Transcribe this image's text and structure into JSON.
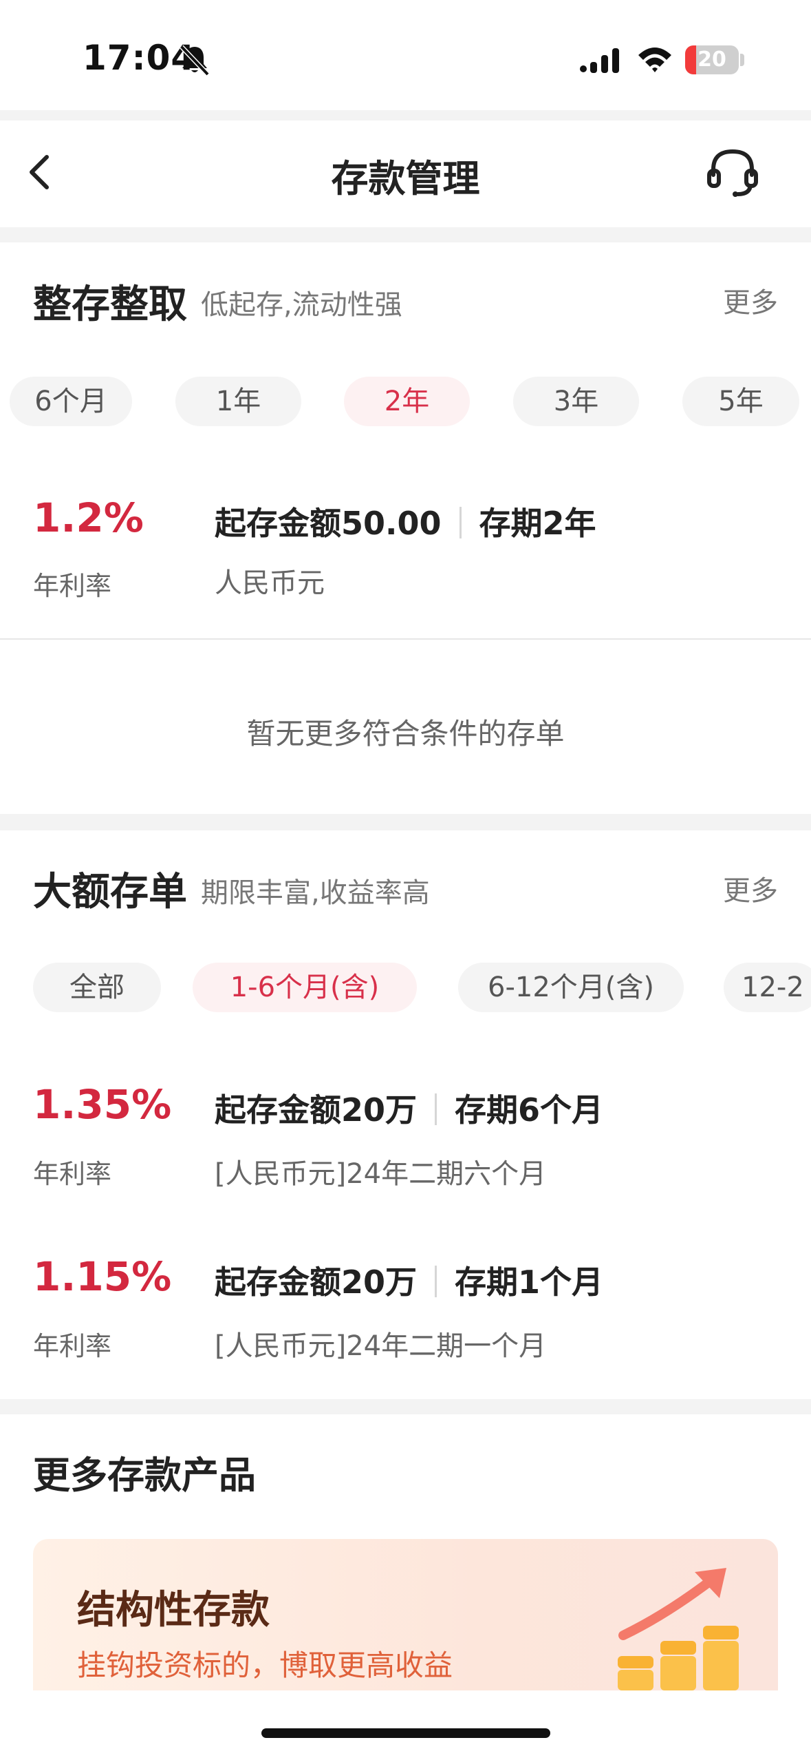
{
  "status": {
    "time": "17:04",
    "battery": 20
  },
  "nav": {
    "title": "存款管理"
  },
  "regular": {
    "title": "整存整取",
    "subtitle": "低起存,流动性强",
    "more": "更多",
    "tabs": [
      "6个月",
      "1年",
      "2年",
      "3年",
      "5年"
    ],
    "active_tab": "2年",
    "product": {
      "rate": "1.2%",
      "rate_label": "年利率",
      "min_amount": "起存金额50.00",
      "term": "存期2年",
      "currency": "人民币元"
    },
    "empty_text": "暂无更多符合条件的存单"
  },
  "large": {
    "title": "大额存单",
    "subtitle": "期限丰富,收益率高",
    "more": "更多",
    "tabs": [
      "全部",
      "1-6个月(含)",
      "6-12个月(含)",
      "12-2"
    ],
    "active_tab": "1-6个月(含)",
    "products": [
      {
        "rate": "1.35%",
        "rate_label": "年利率",
        "min_amount": "起存金额20万",
        "term": "存期6个月",
        "name": "[人民币元]24年二期六个月"
      },
      {
        "rate": "1.15%",
        "rate_label": "年利率",
        "min_amount": "起存金额20万",
        "term": "存期1个月",
        "name": "[人民币元]24年二期一个月"
      }
    ]
  },
  "more_products": {
    "title": "更多存款产品",
    "card": {
      "title": "结构性存款",
      "subtitle": "挂钩投资标的，博取更高收益",
      "icon": "rising-coins-icon"
    }
  },
  "colors": {
    "accent": "#d3283f",
    "active_pill_bg": "#fdf1f2",
    "promo_sub": "#e0613a"
  }
}
